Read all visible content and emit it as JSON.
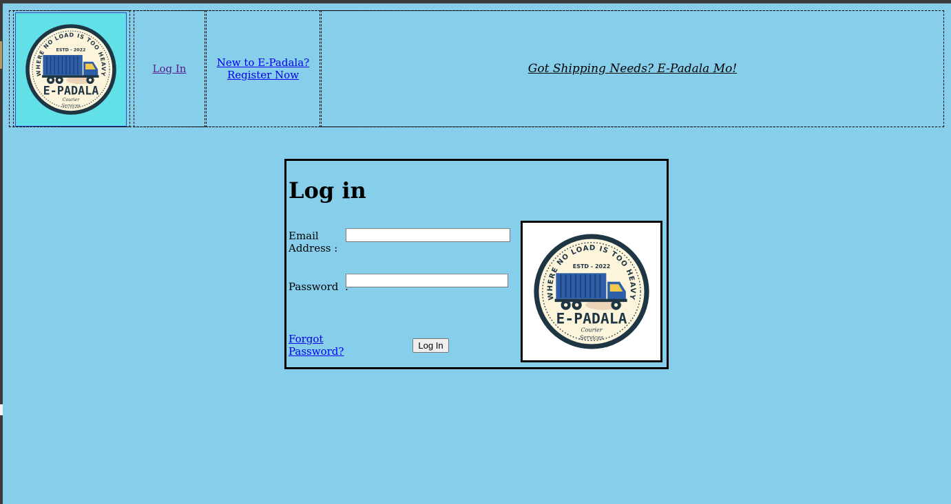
{
  "header": {
    "logo": {
      "arc_text": "WHERE NO LOAD IS TOO HEAVY",
      "estd": "ESTD - 2022",
      "brand": "E-PADALA",
      "sub1": "Courier",
      "sub2": "Services"
    },
    "nav": {
      "login_label": "Log In",
      "register_line1": "New to E-Padala?",
      "register_line2": "Register Now",
      "tagline": "Got Shipping Needs? E-Padala Mo!"
    }
  },
  "login": {
    "title": "Log in",
    "email_label": "Email Address :",
    "email_value": "",
    "password_label": "Password  :",
    "password_value": "",
    "forgot_label": "Forgot Password?",
    "submit_label": "Log In"
  },
  "colors": {
    "page_bg": "#87ceeb",
    "logo_bg": "#62e0e7",
    "link": "#0000ee",
    "visited_link": "#551a8b",
    "badge_dark": "#1e3544",
    "badge_cream": "#fdf4dc",
    "truck_blue": "#2d5fa8",
    "truck_yellow": "#f2c94c"
  }
}
